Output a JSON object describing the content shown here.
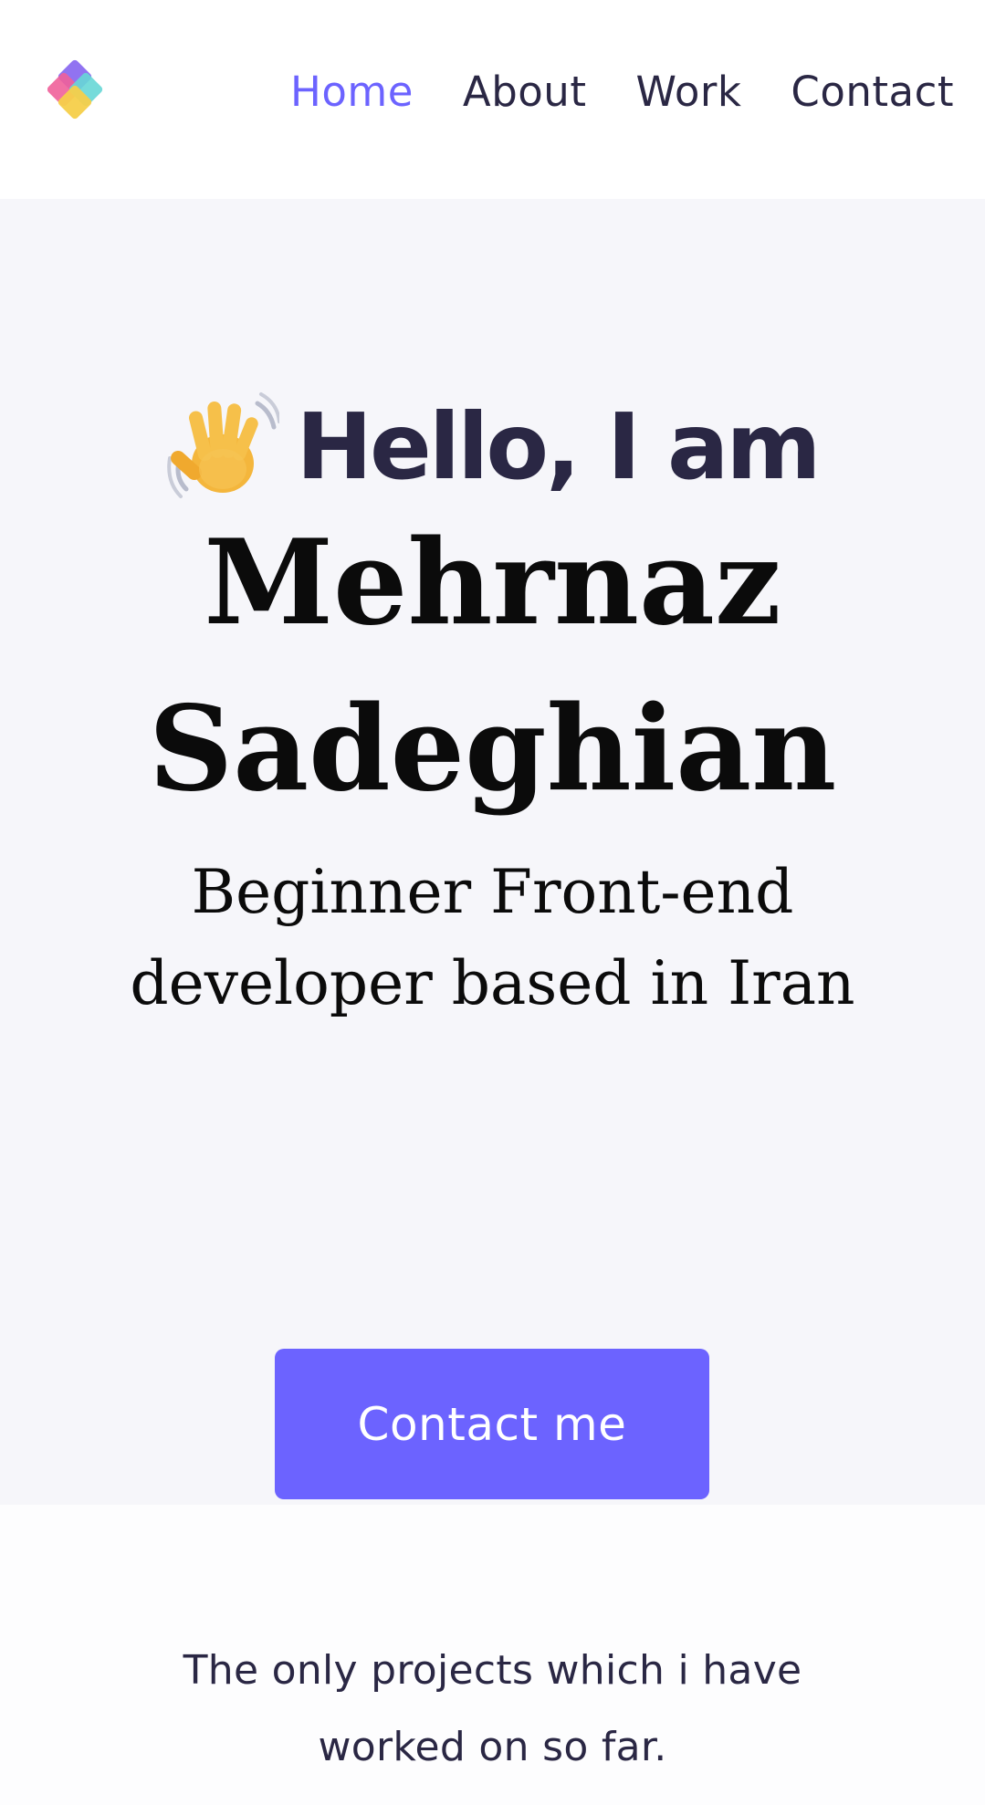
{
  "header": {
    "logo_icon": "diamond-logo-icon",
    "nav": {
      "home": "Home",
      "about": "About",
      "work": "Work",
      "contact": "Contact"
    },
    "active_item": "home"
  },
  "hero": {
    "wave_icon": "waving-hand-icon",
    "greeting": "Hello, I am",
    "name_line1": "Mehrnaz",
    "name_line2": "Sadeghian",
    "tagline": "Beginner Front-end developer based in Iran",
    "cta_label": "Contact me"
  },
  "projects": {
    "intro": "The only projects which i have worked on so far."
  },
  "colors": {
    "accent": "#6c63ff",
    "text_dark": "#2a2744",
    "hero_bg": "#f6f6fa"
  }
}
